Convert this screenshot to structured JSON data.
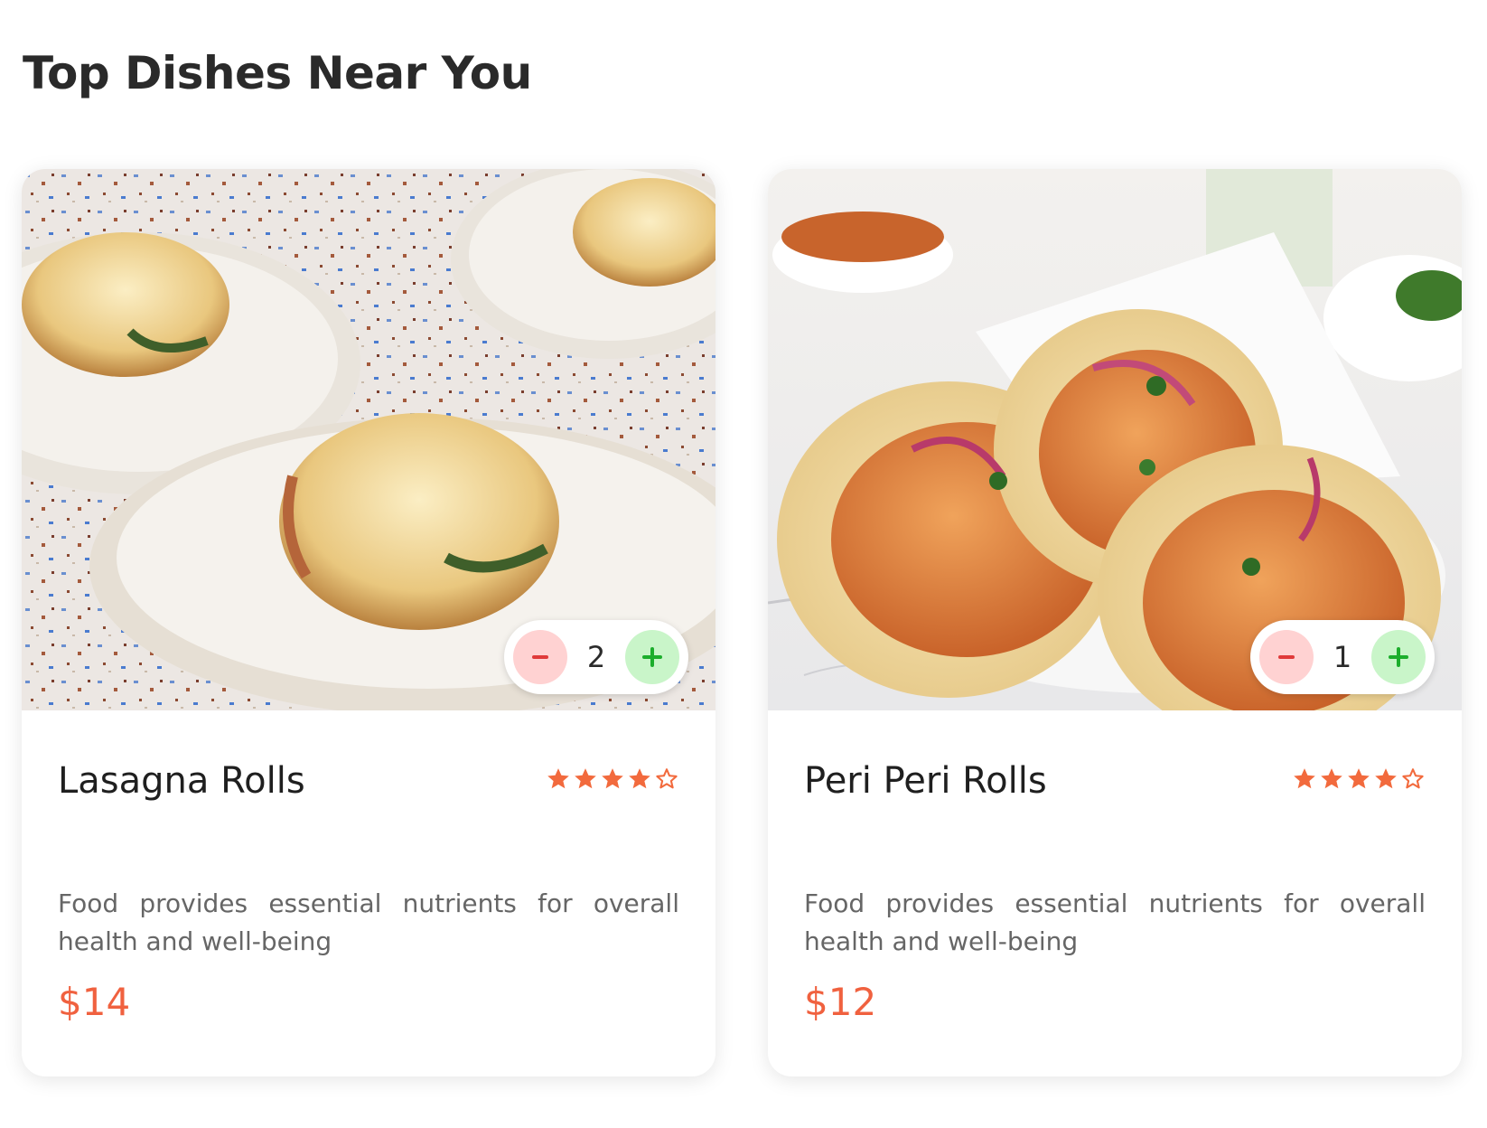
{
  "page": {
    "title": "Top Dishes Near You"
  },
  "colors": {
    "accent": "#f0613f",
    "star": "#f26a3d",
    "minus_bg": "#ffd2d2",
    "minus_icon": "#e03a3a",
    "plus_bg": "#c9f5c9",
    "plus_icon": "#1cae2c"
  },
  "dishes": [
    {
      "name": "Lasagna Rolls",
      "rating": 4,
      "rating_max": 5,
      "description": "Food provides essential nutrients for overall health and well-being",
      "price": "$14",
      "quantity": "2",
      "image": "lasagna-rolls-photo"
    },
    {
      "name": "Peri Peri Rolls",
      "rating": 4,
      "rating_max": 5,
      "description": "Food provides essential nutrients for overall health and well-being",
      "price": "$12",
      "quantity": "1",
      "image": "peri-peri-rolls-photo"
    }
  ]
}
